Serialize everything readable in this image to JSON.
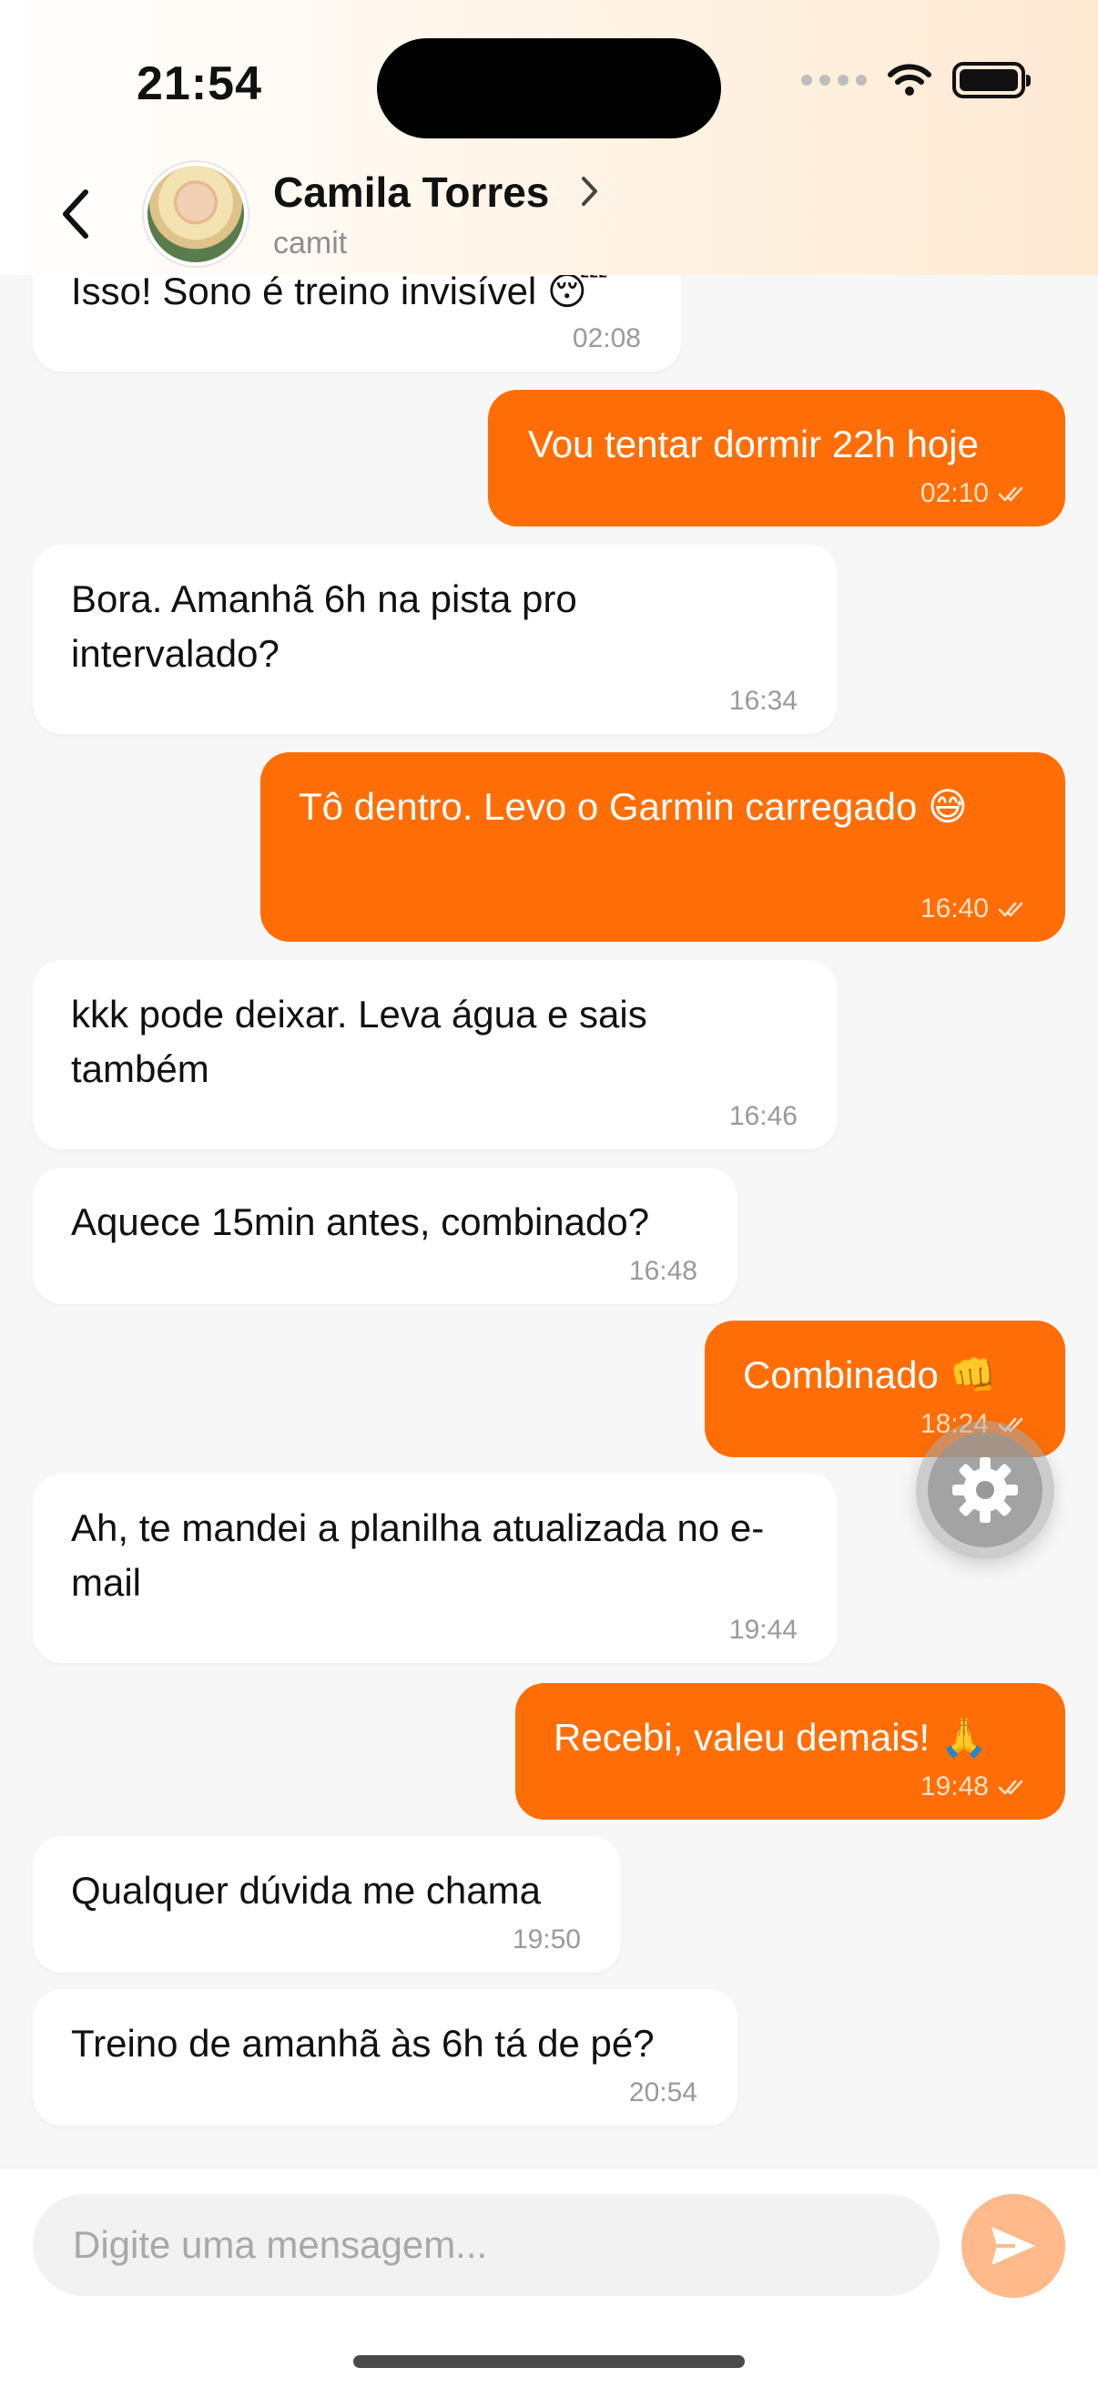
{
  "status_bar": {
    "time": "21:54"
  },
  "header": {
    "name": "Camila Torres",
    "username": "camit"
  },
  "messages": [
    {
      "dir": "in",
      "text": "Isso! Sono é treino invisível 😴",
      "time": "02:08"
    },
    {
      "dir": "out",
      "text": "Vou tentar dormir 22h hoje",
      "time": "02:10",
      "status": "read"
    },
    {
      "dir": "in",
      "text": "Bora. Amanhã 6h na pista pro intervalado?",
      "time": "16:34"
    },
    {
      "dir": "out",
      "text": "Tô dentro. Levo o Garmin carregado 😅",
      "time": "16:40",
      "status": "read"
    },
    {
      "dir": "in",
      "text": "kkk pode deixar. Leva água e sais também",
      "time": "16:46"
    },
    {
      "dir": "in",
      "text": "Aquece 15min antes, combinado?",
      "time": "16:48"
    },
    {
      "dir": "out",
      "text": "Combinado 👊",
      "time": "18:24",
      "status": "read"
    },
    {
      "dir": "in",
      "text": "Ah, te mandei a planilha atualizada no e-mail",
      "time": "19:44"
    },
    {
      "dir": "out",
      "text": "Recebi, valeu demais! 🙏",
      "time": "19:48",
      "status": "read"
    },
    {
      "dir": "in",
      "text": "Qualquer dúvida me chama",
      "time": "19:50"
    },
    {
      "dir": "in",
      "text": "Treino de amanhã às 6h tá de pé?",
      "time": "20:54"
    }
  ],
  "composer": {
    "placeholder": "Digite uma mensagem..."
  },
  "colors": {
    "accent": "#ff6e06",
    "send_disabled": "#ffb98a",
    "incoming_bubble": "#ffffff"
  },
  "icons": {
    "back": "chevron-left-icon",
    "profile": "chevron-right-icon",
    "settings": "gear-icon",
    "send": "send-icon",
    "read": "double-check-icon"
  }
}
